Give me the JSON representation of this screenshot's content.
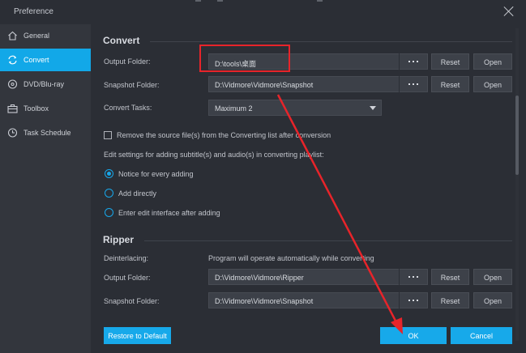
{
  "window": {
    "title": "Preference"
  },
  "sidebar": {
    "items": [
      {
        "label": "General",
        "icon": "home-icon"
      },
      {
        "label": "Convert",
        "icon": "convert-icon"
      },
      {
        "label": "DVD/Blu-ray",
        "icon": "disc-icon"
      },
      {
        "label": "Toolbox",
        "icon": "toolbox-icon"
      },
      {
        "label": "Task Schedule",
        "icon": "clock-icon"
      }
    ],
    "active": "Convert"
  },
  "convert": {
    "heading": "Convert",
    "output_folder_label": "Output Folder:",
    "output_folder_value": "D:\\tools\\桌面",
    "snapshot_folder_label": "Snapshot Folder:",
    "snapshot_folder_value": "D:\\Vidmore\\Vidmore\\Snapshot",
    "tasks_label": "Convert Tasks:",
    "tasks_value": "Maximum 2",
    "remove_source_label": "Remove the source file(s) from the Converting list after conversion",
    "remove_source_checked": false,
    "edit_settings_label": "Edit settings for adding subtitle(s) and audio(s) in converting playlist:",
    "edit_options": [
      {
        "label": "Notice for every adding",
        "selected": true
      },
      {
        "label": "Add directly",
        "selected": false
      },
      {
        "label": "Enter edit interface after adding",
        "selected": false
      }
    ]
  },
  "ripper": {
    "heading": "Ripper",
    "deinterlacing_label": "Deinterlacing:",
    "deinterlacing_value": "Program will operate automatically while converting",
    "output_folder_label": "Output Folder:",
    "output_folder_value": "D:\\Vidmore\\Vidmore\\Ripper",
    "snapshot_folder_label": "Snapshot Folder:",
    "snapshot_folder_value": "D:\\Vidmore\\Vidmore\\Snapshot"
  },
  "buttons": {
    "browse": "···",
    "reset": "Reset",
    "open": "Open",
    "restore": "Restore to Default",
    "ok": "OK",
    "cancel": "Cancel"
  },
  "colors": {
    "accent": "#17a9ea",
    "annotation": "#e7242a",
    "background": "#2b2e35",
    "sidebar": "#33363d"
  }
}
